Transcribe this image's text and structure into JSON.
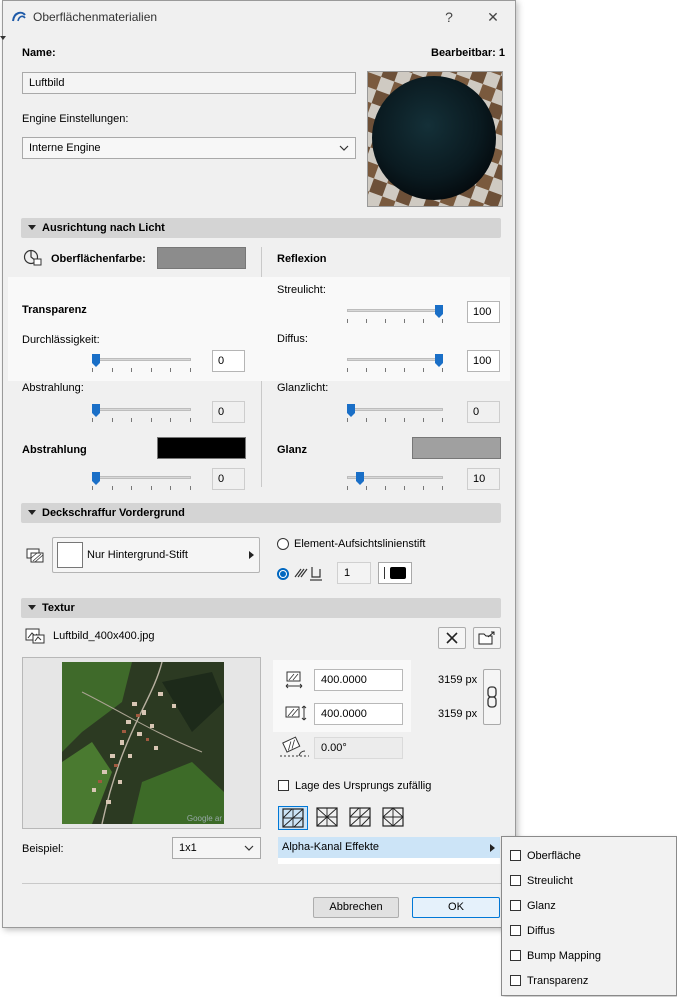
{
  "window": {
    "title": "Oberflächenmaterialien",
    "help": "?",
    "close": "✕"
  },
  "header": {
    "name_label": "Name:",
    "editable_label": "Bearbeitbar: 1",
    "name_value": "Luftbild",
    "engine_label": "Engine Einstellungen:",
    "engine_value": "Interne Engine"
  },
  "section_light": {
    "title": "Ausrichtung nach Licht",
    "surface_color_label": "Oberflächenfarbe:",
    "surface_color": "#8c8c8c",
    "reflexion_label": "Reflexion",
    "transparency_label": "Transparenz",
    "permeability_label": "Durchlässigkeit:",
    "permeability_value": "0",
    "permeability_fraction": 0,
    "emission_label": "Abstrahlung:",
    "emission_value": "0",
    "emission_fraction": 0,
    "emission_color_label": "Abstrahlung",
    "emission_color": "#000000",
    "emission_color_value": "0",
    "emission_color_fraction": 0,
    "diffuse_light_label": "Streulicht:",
    "diffuse_light_value": "100",
    "diffuse_light_fraction": 1,
    "diffuse_label": "Diffus:",
    "diffuse_value": "100",
    "diffuse_fraction": 1,
    "highlight_label": "Glanzlicht:",
    "highlight_value": "0",
    "highlight_fraction": 0,
    "gloss_label": "Glanz",
    "gloss_color": "#a0a0a0",
    "gloss_value": "10",
    "gloss_fraction": 0.1
  },
  "section_hatch": {
    "title": "Deckschraffur Vordergrund",
    "pen_button_label": "Nur Hintergrund-Stift",
    "element_pen_label": "Element-Aufsichtslinienstift",
    "pen_number": "1"
  },
  "section_texture": {
    "title": "Textur",
    "file_name": "Luftbild_400x400.jpg",
    "width_value": "400.0000",
    "height_value": "400.0000",
    "width_px": "3159 px",
    "height_px": "3159 px",
    "angle_value": "0.00°",
    "random_origin_label": "Lage des Ursprungs zufällig",
    "watermark": "Google ar",
    "example_label": "Beispiel:",
    "example_value": "1x1",
    "alpha_label": "Alpha-Kanal Effekte"
  },
  "footer": {
    "cancel_label": "Abbrechen",
    "ok_label": "OK"
  },
  "alpha_menu": {
    "items": [
      {
        "label": "Oberfläche"
      },
      {
        "label": "Streulicht"
      },
      {
        "label": "Glanz"
      },
      {
        "label": "Diffus"
      },
      {
        "label": "Bump Mapping"
      },
      {
        "label": "Transparenz"
      }
    ]
  },
  "colors": {
    "accent": "#0067c0",
    "slider_thumb": "#1a6fc7"
  }
}
